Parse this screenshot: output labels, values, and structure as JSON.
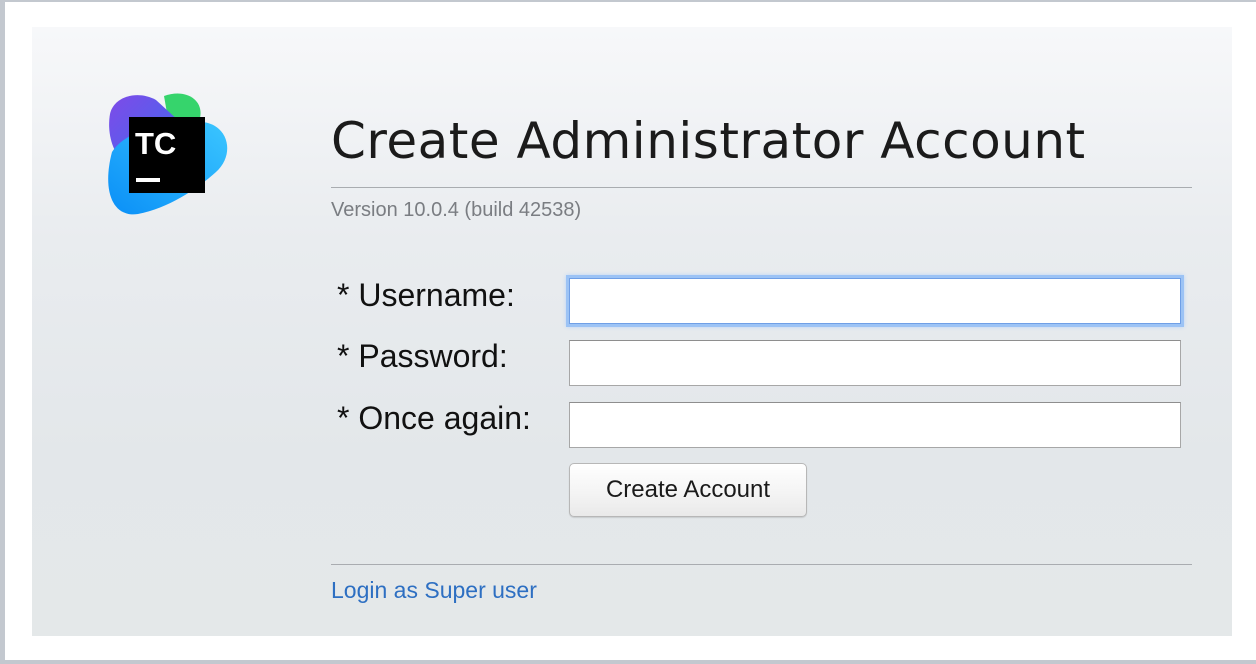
{
  "page": {
    "title": "Create Administrator Account",
    "version": "Version 10.0.4 (build 42538)"
  },
  "logo": {
    "text": "TC",
    "icon": "teamcity-logo-icon"
  },
  "form": {
    "username_label": "* Username:",
    "username_value": "",
    "password_label": "* Password:",
    "password_value": "",
    "confirm_label": "* Once again:",
    "confirm_value": "",
    "submit_label": "Create Account"
  },
  "footer": {
    "super_user_link": "Login as Super user"
  },
  "colors": {
    "link": "#2d6fc2",
    "focus_ring": "#9cc3f5",
    "logo_box": "#000000"
  }
}
